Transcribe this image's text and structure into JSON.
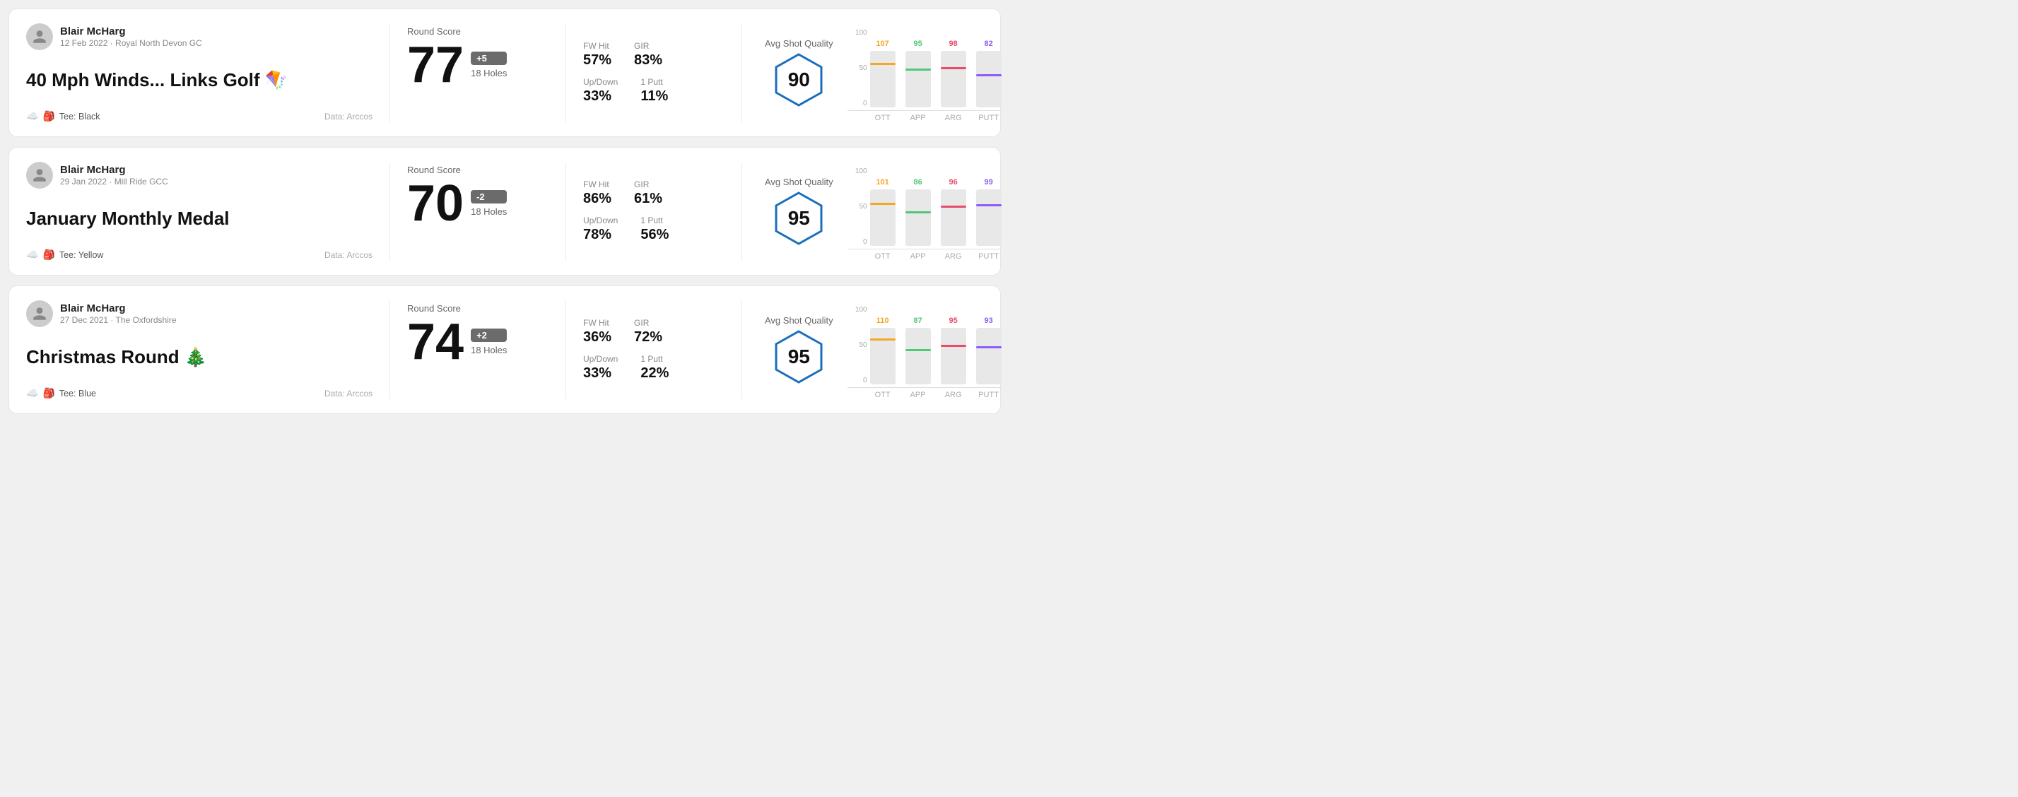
{
  "rounds": [
    {
      "id": "round1",
      "user": {
        "name": "Blair McHarg",
        "date": "12 Feb 2022 · Royal North Devon GC"
      },
      "title": "40 Mph Winds... Links Golf 🪁",
      "tee": "Black",
      "data_source": "Data: Arccos",
      "score": {
        "value": "77",
        "badge": "+5",
        "badge_type": "over",
        "holes": "18 Holes",
        "label": "Round Score"
      },
      "stats": {
        "fw_hit_label": "FW Hit",
        "fw_hit_value": "57%",
        "gir_label": "GIR",
        "gir_value": "83%",
        "updown_label": "Up/Down",
        "updown_value": "33%",
        "oneputt_label": "1 Putt",
        "oneputt_value": "11%"
      },
      "quality": {
        "label": "Avg Shot Quality",
        "score": "90"
      },
      "chart": {
        "bars": [
          {
            "category": "OTT",
            "value": 107,
            "color_class": "line-ott",
            "value_color": "color-ott",
            "height_pct": 75
          },
          {
            "category": "APP",
            "value": 95,
            "color_class": "line-app",
            "value_color": "color-app",
            "height_pct": 65
          },
          {
            "category": "ARG",
            "value": 98,
            "color_class": "line-arg",
            "value_color": "color-arg",
            "height_pct": 68
          },
          {
            "category": "PUTT",
            "value": 82,
            "color_class": "line-putt",
            "value_color": "color-putt",
            "height_pct": 55
          }
        ]
      }
    },
    {
      "id": "round2",
      "user": {
        "name": "Blair McHarg",
        "date": "29 Jan 2022 · Mill Ride GCC"
      },
      "title": "January Monthly Medal",
      "tee": "Yellow",
      "data_source": "Data: Arccos",
      "score": {
        "value": "70",
        "badge": "-2",
        "badge_type": "under",
        "holes": "18 Holes",
        "label": "Round Score"
      },
      "stats": {
        "fw_hit_label": "FW Hit",
        "fw_hit_value": "86%",
        "gir_label": "GIR",
        "gir_value": "61%",
        "updown_label": "Up/Down",
        "updown_value": "78%",
        "oneputt_label": "1 Putt",
        "oneputt_value": "56%"
      },
      "quality": {
        "label": "Avg Shot Quality",
        "score": "95"
      },
      "chart": {
        "bars": [
          {
            "category": "OTT",
            "value": 101,
            "color_class": "line-ott",
            "value_color": "color-ott",
            "height_pct": 72
          },
          {
            "category": "APP",
            "value": 86,
            "color_class": "line-app",
            "value_color": "color-app",
            "height_pct": 58
          },
          {
            "category": "ARG",
            "value": 96,
            "color_class": "line-arg",
            "value_color": "color-arg",
            "height_pct": 67
          },
          {
            "category": "PUTT",
            "value": 99,
            "color_class": "line-putt",
            "value_color": "color-putt",
            "height_pct": 70
          }
        ]
      }
    },
    {
      "id": "round3",
      "user": {
        "name": "Blair McHarg",
        "date": "27 Dec 2021 · The Oxfordshire"
      },
      "title": "Christmas Round 🎄",
      "tee": "Blue",
      "data_source": "Data: Arccos",
      "score": {
        "value": "74",
        "badge": "+2",
        "badge_type": "over",
        "holes": "18 Holes",
        "label": "Round Score"
      },
      "stats": {
        "fw_hit_label": "FW Hit",
        "fw_hit_value": "36%",
        "gir_label": "GIR",
        "gir_value": "72%",
        "updown_label": "Up/Down",
        "updown_value": "33%",
        "oneputt_label": "1 Putt",
        "oneputt_value": "22%"
      },
      "quality": {
        "label": "Avg Shot Quality",
        "score": "95"
      },
      "chart": {
        "bars": [
          {
            "category": "OTT",
            "value": 110,
            "color_class": "line-ott",
            "value_color": "color-ott",
            "height_pct": 78
          },
          {
            "category": "APP",
            "value": 87,
            "color_class": "line-app",
            "value_color": "color-app",
            "height_pct": 59
          },
          {
            "category": "ARG",
            "value": 95,
            "color_class": "line-arg",
            "value_color": "color-arg",
            "height_pct": 66
          },
          {
            "category": "PUTT",
            "value": 93,
            "color_class": "line-putt",
            "value_color": "color-putt",
            "height_pct": 64
          }
        ]
      }
    }
  ],
  "y_axis": [
    "100",
    "50",
    "0"
  ]
}
